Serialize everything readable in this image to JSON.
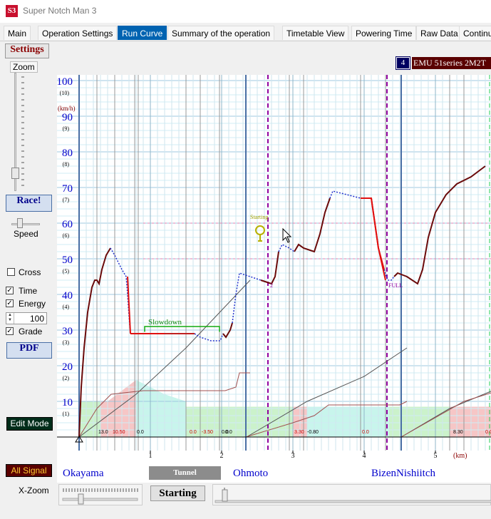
{
  "app": {
    "title": "Super Notch Man 3",
    "icon_text": "S3"
  },
  "tabs": [
    {
      "label": "Main"
    },
    {
      "label": "Operation Settings"
    },
    {
      "label": "Run Curve",
      "active": true
    },
    {
      "label": "Summary of the operation"
    },
    {
      "label": "Timetable View"
    },
    {
      "label": "Powering Time"
    },
    {
      "label": "Raw Data"
    },
    {
      "label": "Continu"
    }
  ],
  "left": {
    "settings_label": "Settings",
    "zoom_label": "Zoom",
    "race_label": "Race!",
    "speed_label": "Speed",
    "cross_label": "Cross",
    "time_label": "Time",
    "energy_label": "Energy",
    "energy_value": "100",
    "grade_label": "Grade",
    "pdf_label": "PDF",
    "edit_mode_label": "Edit Mode",
    "all_signal_label": "All Signal",
    "x_zoom_label": "X-Zoom",
    "cross_checked": false,
    "time_checked": true,
    "energy_checked": true,
    "grade_checked": true
  },
  "train": {
    "number": "4",
    "name": "EMU 51series  2M2T"
  },
  "chart_data": {
    "type": "line",
    "ylabel": "(km/h)",
    "y_ticks": [
      {
        "v": 100,
        "sub": "(10)"
      },
      {
        "v": 90,
        "sub": "(9)"
      },
      {
        "v": 80,
        "sub": "(8)"
      },
      {
        "v": 70,
        "sub": "(7)"
      },
      {
        "v": 60,
        "sub": "(6)"
      },
      {
        "v": 50,
        "sub": "(5)"
      },
      {
        "v": 40,
        "sub": "(4)"
      },
      {
        "v": 30,
        "sub": "(3)"
      },
      {
        "v": 20,
        "sub": "(2)"
      },
      {
        "v": 10,
        "sub": "(1)"
      }
    ],
    "ylim": [
      0,
      100
    ],
    "xlim": [
      -0.05,
      5.8
    ],
    "x_ticks": [
      "1",
      "2",
      "3",
      "4",
      "5"
    ],
    "x_unit": "(km)",
    "annotations": {
      "slowdown": "Slowdown",
      "starting": "Starting",
      "full": "FULL",
      "two": "2"
    },
    "grade_labels": [
      "13.0",
      "10.50",
      "0.0",
      "0.0",
      "0.0",
      "-3.50",
      "0.0",
      "3.30",
      "-0.80",
      "0.0",
      "8.30",
      "0.0"
    ],
    "speed_curve": [
      [
        0,
        0
      ],
      [
        0.03,
        14
      ],
      [
        0.07,
        25
      ],
      [
        0.12,
        35
      ],
      [
        0.18,
        42
      ],
      [
        0.22,
        44
      ],
      [
        0.25,
        44
      ],
      [
        0.28,
        43
      ],
      [
        0.32,
        47
      ],
      [
        0.38,
        51
      ],
      [
        0.44,
        53
      ],
      [
        0.5,
        51
      ],
      [
        0.6,
        47
      ],
      [
        0.66,
        45
      ],
      [
        0.68,
        40
      ],
      [
        0.7,
        34
      ],
      [
        0.72,
        29
      ],
      [
        1.2,
        29
      ],
      [
        1.55,
        29
      ],
      [
        1.62,
        29
      ],
      [
        1.7,
        28
      ],
      [
        1.85,
        27
      ],
      [
        1.98,
        27
      ],
      [
        2.02,
        29
      ],
      [
        2.06,
        28
      ],
      [
        2.12,
        30
      ],
      [
        2.15,
        32
      ],
      [
        2.2,
        40
      ],
      [
        2.25,
        46
      ],
      [
        2.55,
        44
      ],
      [
        2.7,
        43
      ],
      [
        2.75,
        45
      ],
      [
        2.8,
        52
      ],
      [
        2.85,
        54
      ],
      [
        2.95,
        53
      ],
      [
        3.02,
        52
      ],
      [
        3.08,
        54
      ],
      [
        3.15,
        53
      ],
      [
        3.3,
        52
      ],
      [
        3.38,
        57
      ],
      [
        3.45,
        63
      ],
      [
        3.52,
        67
      ],
      [
        3.56,
        69
      ],
      [
        3.95,
        67
      ],
      [
        4.1,
        67
      ],
      [
        4.15,
        60
      ],
      [
        4.2,
        53
      ],
      [
        4.28,
        47
      ],
      [
        4.33,
        44
      ],
      [
        4.38,
        44
      ],
      [
        4.42,
        45
      ],
      [
        4.47,
        46
      ],
      [
        4.6,
        45
      ],
      [
        4.75,
        43
      ],
      [
        4.82,
        47
      ],
      [
        4.9,
        56
      ],
      [
        5.0,
        63
      ],
      [
        5.15,
        68
      ],
      [
        5.3,
        71
      ],
      [
        5.5,
        73
      ],
      [
        5.7,
        76
      ]
    ],
    "braking_segments": [
      [
        [
          0.68,
          45
        ],
        [
          0.72,
          29
        ]
      ],
      [
        [
          4.1,
          67
        ],
        [
          4.2,
          53
        ],
        [
          4.3,
          44
        ]
      ]
    ]
  },
  "bottom": {
    "tunnel_label": "Tunnel",
    "stations": [
      "Okayama",
      "Ohmoto",
      "BizenNishiitch"
    ],
    "starting_label": "Starting"
  }
}
